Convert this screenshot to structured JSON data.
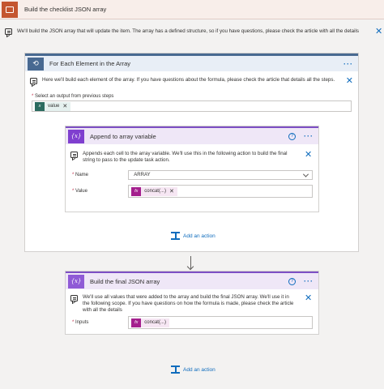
{
  "scope": {
    "title": "Build the checklist JSON array",
    "note": "We'll build the JSON array that will update the item. The array has a defined structure, so if you have questions, please check the article with all the details"
  },
  "foreach": {
    "title": "For Each Element in the Array",
    "note": "Here we'll build each element of the array. If you have questions about the formula, please check the article that details all the steps.",
    "select_label": "Select an output from previous steps",
    "token": {
      "label": "value",
      "icon": "x"
    }
  },
  "append": {
    "title": "Append to array variable",
    "icon": "{x}",
    "note": "Appends each cell to the array variable. We'll use this in the following action to build the final string to pass to the update task action.",
    "name_label": "Name",
    "name_value": "ARRAY",
    "value_label": "Value",
    "value_token": "concat(...)",
    "fx_icon": "fx"
  },
  "add_action_label": "Add an action",
  "final": {
    "title": "Build the final JSON array",
    "icon": "{x}",
    "note": "We'll use all values that were added to the array and build the final JSON array. We'll use it in the following scope. If you have questions on how the formula is made, please check the article with all the details",
    "inputs_label": "Inputs",
    "inputs_token": "concat(...)",
    "fx_icon": "fx"
  },
  "colors": {
    "scope_accent": "#c4552f",
    "foreach_accent": "#486991",
    "variable_accent": "#7f3fcf",
    "token_expression": "#a4208e",
    "token_dynamic": "#2b6b5f",
    "link": "#0f6cbd"
  }
}
